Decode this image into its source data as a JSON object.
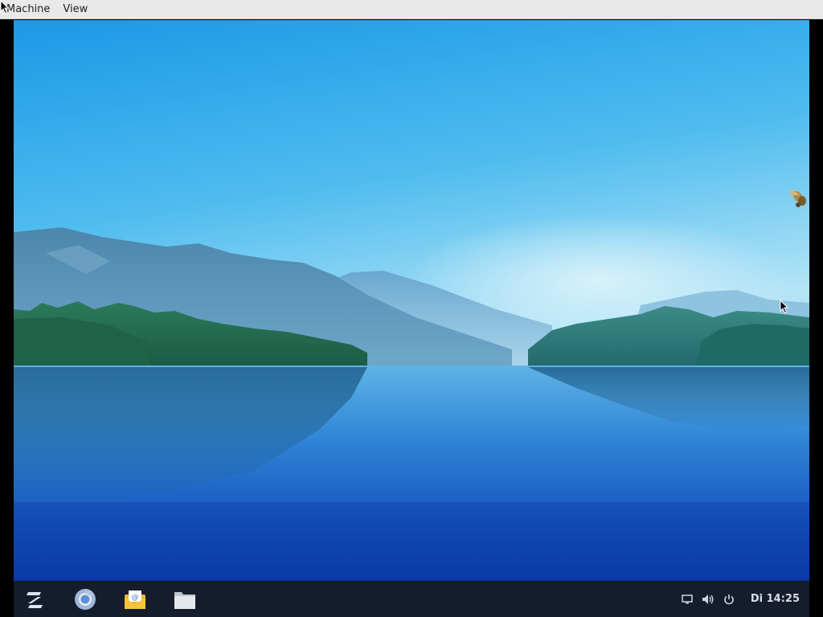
{
  "host_menu": {
    "items": [
      {
        "label": "Machine"
      },
      {
        "label": "View"
      }
    ]
  },
  "taskbar": {
    "launchers": [
      {
        "icon": "zorin-menu-icon",
        "name": "app-menu"
      },
      {
        "icon": "chrome-icon",
        "name": "web-browser"
      },
      {
        "icon": "mail-icon",
        "name": "email-client"
      },
      {
        "icon": "folder-icon",
        "name": "files"
      }
    ],
    "tray": {
      "icons": [
        "display-icon",
        "volume-icon",
        "power-icon"
      ],
      "clock": "Di 14:25"
    },
    "color": "#151c2b"
  },
  "wallpaper": {
    "description_colors": {
      "sky_top": "#1a9ae6",
      "sky_bottom": "#a6e0f5",
      "water_bottom": "#0c3ca8"
    }
  }
}
